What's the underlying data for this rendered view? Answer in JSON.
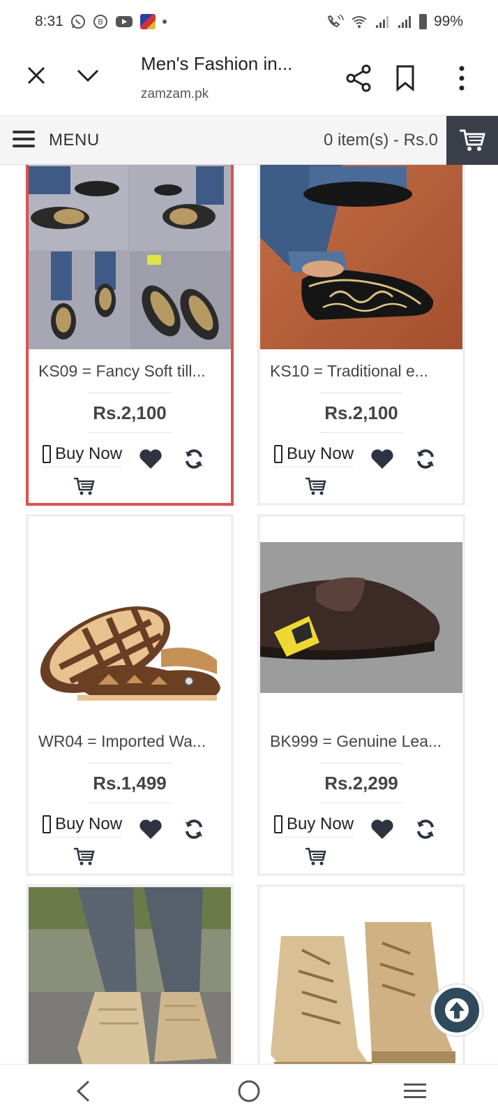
{
  "status": {
    "time": "8:31",
    "battery": "99%",
    "left_icons": [
      "whatsapp-icon",
      "b-circle-icon",
      "youtube-icon",
      "app-tile-icon",
      "dot-icon"
    ],
    "right_icons": [
      "wifi-calling-icon",
      "wifi-icon",
      "signal-icon",
      "signal-icon",
      "battery-icon"
    ]
  },
  "browser": {
    "title": "Men's Fashion in...",
    "domain": "zamzam.pk"
  },
  "shop": {
    "menu_label": "MENU",
    "cart_summary": "0 item(s) - Rs.0"
  },
  "products": [
    {
      "name": "KS09 = Fancy Soft till...",
      "price": "Rs.2,100",
      "buy_label": "Buy Now"
    },
    {
      "name": "KS10 = Traditional e...",
      "price": "Rs.2,100",
      "buy_label": "Buy Now"
    },
    {
      "name": "WR04 = Imported Wa...",
      "price": "Rs.1,499",
      "buy_label": "Buy Now"
    },
    {
      "name": "BK999 = Genuine Lea...",
      "price": "Rs.2,299",
      "buy_label": "Buy Now"
    },
    {
      "name": "",
      "price": "",
      "buy_label": ""
    },
    {
      "name": "",
      "price": "",
      "buy_label": ""
    }
  ],
  "colors": {
    "active_border": "#d9534f",
    "cart_button_bg": "#3a3f4a",
    "fab_bg": "#2f4a5c",
    "icon_dark": "#2d3340"
  }
}
